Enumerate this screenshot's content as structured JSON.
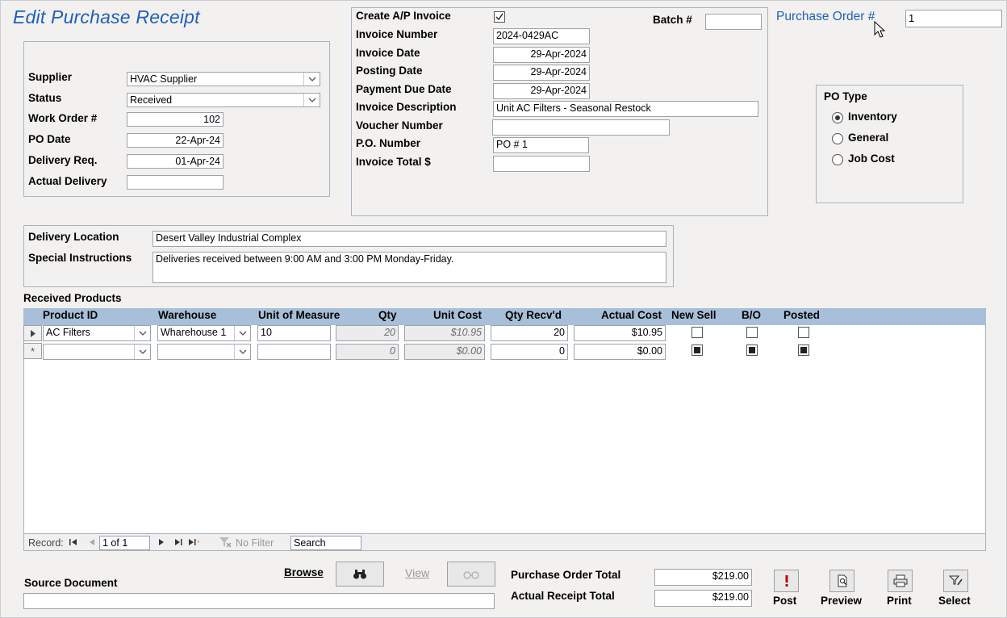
{
  "form": {
    "title": "Edit Purchase Receipt"
  },
  "supplier_box": {
    "supplier_label": "Supplier",
    "supplier_value": "HVAC Supplier",
    "status_label": "Status",
    "status_value": "Received",
    "work_order_label": "Work Order #",
    "work_order_value": "102",
    "po_date_label": "PO Date",
    "po_date_value": "22-Apr-24",
    "delivery_req_label": "Delivery Req.",
    "delivery_req_value": "01-Apr-24",
    "actual_delivery_label": "Actual Delivery",
    "actual_delivery_value": ""
  },
  "invoice_box": {
    "create_ap_label": "Create A/P Invoice",
    "create_ap_checked": true,
    "batch_label": "Batch #",
    "batch_value": "",
    "invoice_number_label": "Invoice Number",
    "invoice_number_value": "2024-0429AC",
    "invoice_date_label": "Invoice Date",
    "invoice_date_value": "29-Apr-2024",
    "posting_date_label": "Posting Date",
    "posting_date_value": "29-Apr-2024",
    "payment_due_label": "Payment Due Date",
    "payment_due_value": "29-Apr-2024",
    "description_label": "Invoice Description",
    "description_value": "Unit AC Filters - Seasonal Restock",
    "voucher_label": "Voucher Number",
    "voucher_value": "",
    "po_number_label": "P.O. Number",
    "po_number_value": "PO # 1",
    "invoice_total_label": "Invoice Total $",
    "invoice_total_value": ""
  },
  "purchase_order": {
    "label": "Purchase Order #",
    "value": "1"
  },
  "po_type": {
    "label": "PO Type",
    "options": [
      {
        "label": "Inventory",
        "selected": true
      },
      {
        "label": "General",
        "selected": false
      },
      {
        "label": "Job Cost",
        "selected": false
      }
    ]
  },
  "delivery": {
    "location_label": "Delivery Location",
    "location_value": "Desert Valley Industrial Complex",
    "instructions_label": "Special Instructions",
    "instructions_value": "Deliveries received between 9:00 AM and 3:00 PM Monday-Friday."
  },
  "products": {
    "section_label": "Received Products",
    "columns": [
      "Product ID",
      "Warehouse",
      "Unit of Measure",
      "Qty",
      "Unit Cost",
      "Qty Recv'd",
      "Actual Cost",
      "New Sell",
      "B/O",
      "Posted"
    ],
    "rows": [
      {
        "product_id": "AC Filters",
        "warehouse": "Wharehouse 1",
        "uom": "10",
        "qty": "20",
        "unit_cost": "$10.95",
        "qty_recvd": "20",
        "actual_cost": "$10.95",
        "new_sell": false,
        "bo": false,
        "posted": false
      },
      {
        "product_id": "",
        "warehouse": "",
        "uom": "",
        "qty": "0",
        "unit_cost": "$0.00",
        "qty_recvd": "0",
        "actual_cost": "$0.00",
        "new_sell": true,
        "bo": true,
        "posted": true
      }
    ],
    "new_row_marker": "*"
  },
  "navigation": {
    "record_label": "Record:",
    "record_value": "1 of 1",
    "no_filter_label": "No Filter",
    "search_placeholder": "Search"
  },
  "footer": {
    "source_doc_label": "Source Document",
    "source_doc_value": "",
    "browse_label": "Browse",
    "view_label": "View",
    "po_total_label": "Purchase Order Total",
    "po_total_value": "$219.00",
    "actual_total_label": "Actual Receipt Total",
    "actual_total_value": "$219.00",
    "post_label": "Post",
    "preview_label": "Preview",
    "print_label": "Print",
    "select_label": "Select"
  },
  "colors": {
    "title": "#1f5fbf",
    "grid_header": "#a7bfd8",
    "post_icon": "#c00000"
  }
}
